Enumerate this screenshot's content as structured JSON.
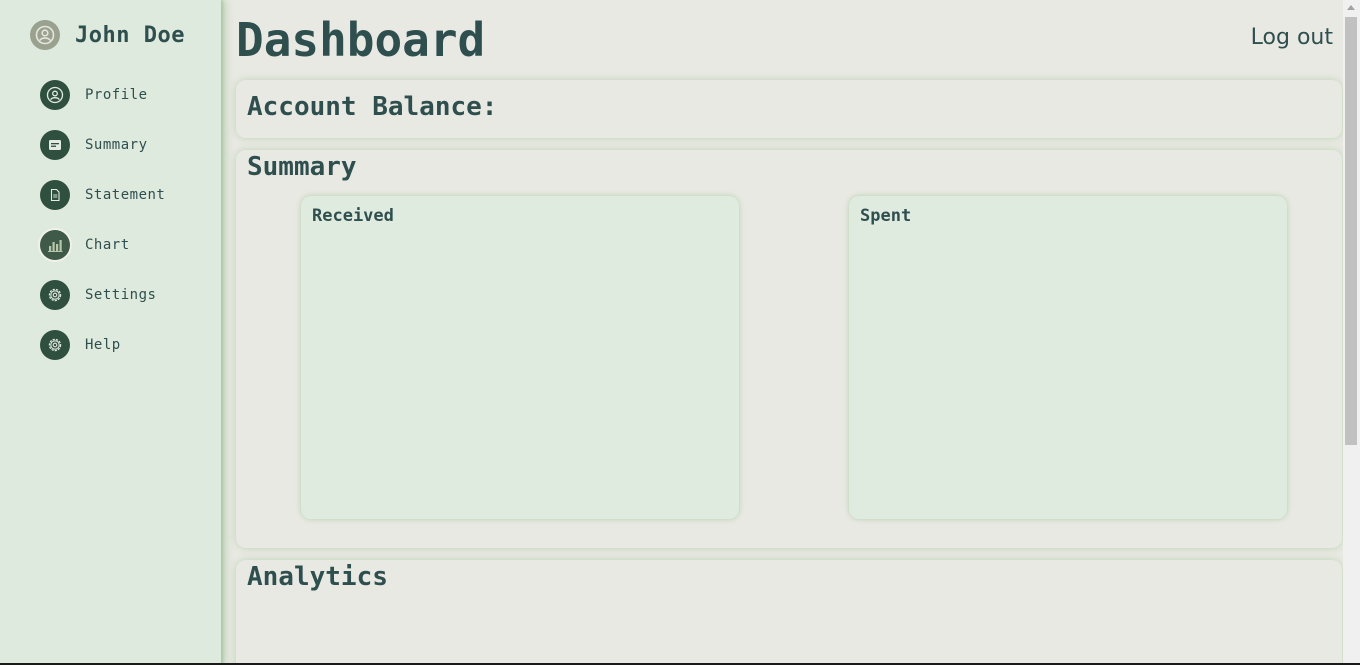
{
  "user": {
    "name": "John Doe",
    "avatar_icon": "user-circle-icon"
  },
  "nav": {
    "items": [
      {
        "label": "Profile",
        "icon": "user-icon"
      },
      {
        "label": "Summary",
        "icon": "card-icon"
      },
      {
        "label": "Statement",
        "icon": "document-icon"
      },
      {
        "label": "Chart",
        "icon": "bar-chart-icon"
      },
      {
        "label": "Settings",
        "icon": "gear-icon"
      },
      {
        "label": "Help",
        "icon": "gear-icon"
      }
    ]
  },
  "header": {
    "title": "Dashboard",
    "logout_label": "Log out"
  },
  "balance": {
    "title": "Account Balance:"
  },
  "summary": {
    "title": "Summary",
    "received_title": "Received",
    "spent_title": "Spent"
  },
  "analytics": {
    "title": "Analytics"
  },
  "colors": {
    "sidebar_bg": "#deeadd",
    "page_bg": "#e9e9e3",
    "text": "#2f4f4f",
    "icon_bg": "#2f4f3f",
    "subcard_bg": "#e0ebe0"
  }
}
